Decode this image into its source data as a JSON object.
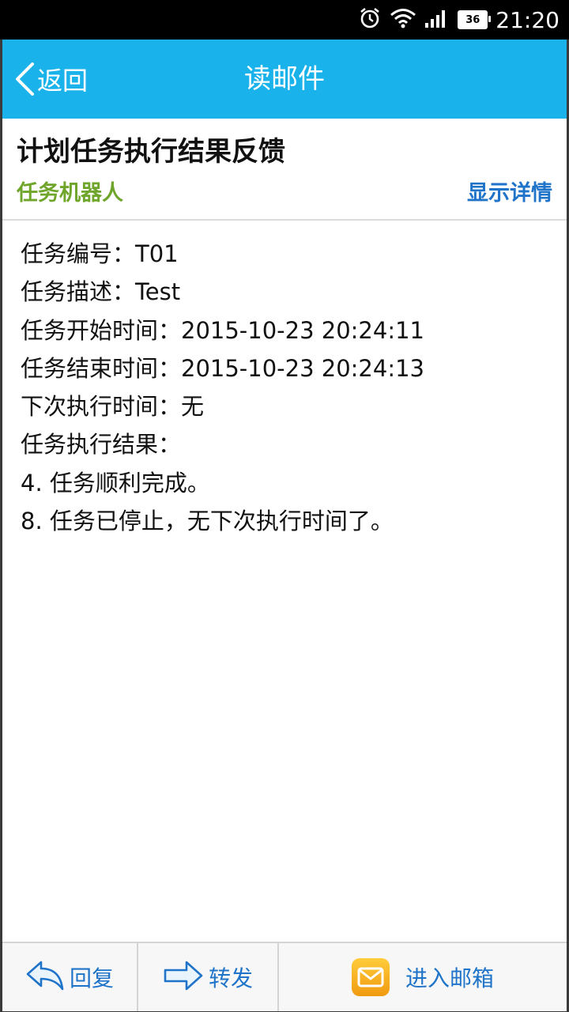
{
  "status_bar": {
    "time": "21:20",
    "battery": "36",
    "icons": [
      "alarm-icon",
      "wifi-icon",
      "signal-icon",
      "battery-icon"
    ]
  },
  "header": {
    "back_label": "返回",
    "title": "读邮件"
  },
  "mail": {
    "subject": "计划任务执行结果反馈",
    "sender": "任务机器人",
    "details_link": "显示详情",
    "body_lines": [
      "任务编号：T01",
      "任务描述：Test",
      "任务开始时间：2015-10-23 20:24:11",
      "任务结束时间：2015-10-23 20:24:13",
      "下次执行时间：无",
      "任务执行结果：",
      "4. 任务顺利完成。",
      "8. 任务已停止，无下次执行时间了。"
    ]
  },
  "bottom_bar": {
    "reply_label": "回复",
    "forward_label": "转发",
    "mailbox_label": "进入邮箱"
  },
  "colors": {
    "header_bg": "#1ab2ea",
    "sender": "#6fa52a",
    "link": "#1f74c9"
  }
}
